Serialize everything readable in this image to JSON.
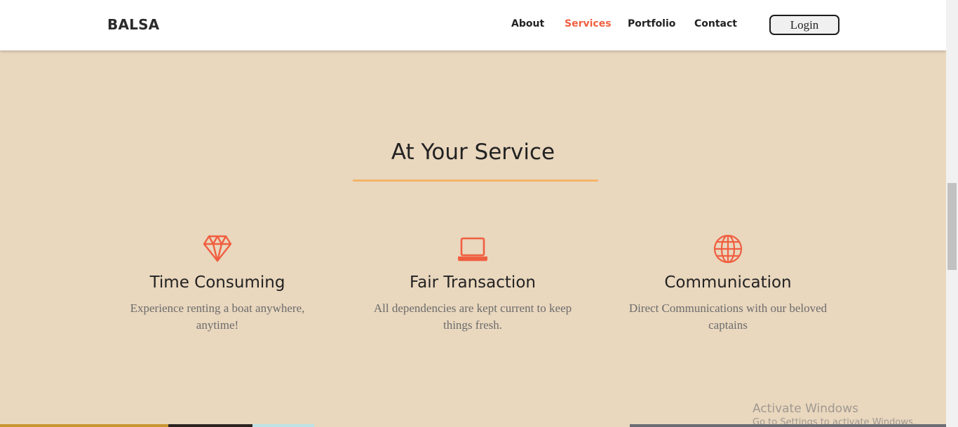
{
  "navbar": {
    "brand": "BALSA",
    "links": [
      "About",
      "Services",
      "Portfolio",
      "Contact"
    ],
    "active": "Services",
    "login_label": "Login"
  },
  "section": {
    "title": "At Your Service"
  },
  "services": [
    {
      "icon": "diamond-icon",
      "title": "Time Consuming",
      "desc": "Experience renting a boat anywhere, anytime!"
    },
    {
      "icon": "laptop-icon",
      "title": "Fair Transaction",
      "desc": "All dependencies are kept current to keep things fresh."
    },
    {
      "icon": "globe-icon",
      "title": "Communication",
      "desc": "Direct Communications with our beloved captains"
    }
  ],
  "watermark": {
    "line1": "Activate Windows",
    "line2": "Go to Settings to activate Windows."
  },
  "colors": {
    "accent": "#f05f40",
    "background": "#e9d7be",
    "divider": "#f4b46a"
  }
}
